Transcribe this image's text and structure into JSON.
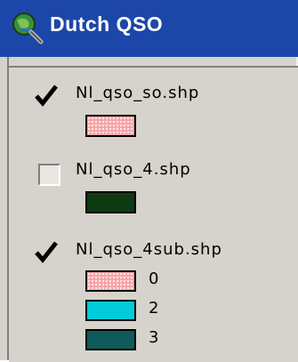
{
  "window": {
    "title": "Dutch QSO",
    "title_icon": "globe-magnifier-icon",
    "title_color": "#1c46a8"
  },
  "layers": [
    {
      "name": "Nl_qso_so.shp",
      "checked": true,
      "legend": [
        {
          "label": "",
          "color": "#f5a6a8",
          "pattern": "dotted"
        }
      ]
    },
    {
      "name": "Nl_qso_4.shp",
      "checked": false,
      "legend": [
        {
          "label": "",
          "color": "#0e3a12"
        }
      ]
    },
    {
      "name": "Nl_qso_4sub.shp",
      "checked": true,
      "legend": [
        {
          "label": "0",
          "color": "#f5a6a8",
          "pattern": "dotted"
        },
        {
          "label": "2",
          "color": "#00cbd8"
        },
        {
          "label": "3",
          "color": "#0f5a5a"
        }
      ]
    }
  ]
}
